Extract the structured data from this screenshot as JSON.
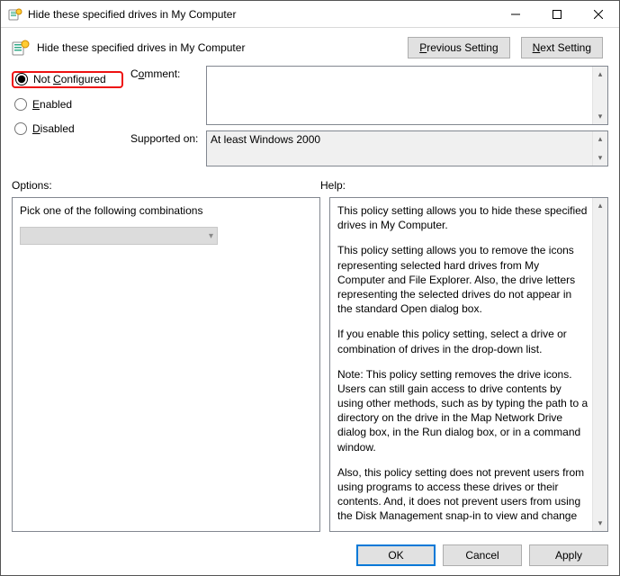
{
  "window": {
    "title": "Hide these specified drives in My Computer",
    "subtitle": "Hide these specified drives in My Computer"
  },
  "nav": {
    "previous_prefix": "P",
    "previous_rest": "revious Setting",
    "next_prefix": "N",
    "next_rest": "ext Setting"
  },
  "state": {
    "not_configured_prefix": "Not ",
    "not_configured_u": "C",
    "not_configured_rest": "onfigured",
    "enabled_u": "E",
    "enabled_rest": "nabled",
    "disabled_u": "D",
    "disabled_rest": "isabled"
  },
  "fields": {
    "comment_label_u": "o",
    "comment_label_pre": "C",
    "comment_label_post": "mment:",
    "comment_value": "",
    "supported_label": "Supported on:",
    "supported_value": "At least Windows 2000"
  },
  "sections": {
    "options_label": "Options:",
    "help_label": "Help:"
  },
  "options": {
    "combo_label": "Pick one of the following combinations",
    "selected": ""
  },
  "help": {
    "p1": "This policy setting allows you to hide these specified drives in My Computer.",
    "p2": "This policy setting allows you to remove the icons representing selected hard drives from My Computer and File Explorer. Also, the drive letters representing the selected drives do not appear in the standard Open dialog box.",
    "p3": "If you enable this policy setting, select a drive or combination of drives in the drop-down list.",
    "p4": "Note: This policy setting removes the drive icons. Users can still gain access to drive contents by using other methods, such as by typing the path to a directory on the drive in the Map Network Drive dialog box, in the Run dialog box, or in a command window.",
    "p5": "Also, this policy setting does not prevent users from using programs to access these drives or their contents. And, it does not prevent users from using the Disk Management snap-in to view and change drive characteristics."
  },
  "buttons": {
    "ok": "OK",
    "cancel": "Cancel",
    "apply": "Apply"
  }
}
